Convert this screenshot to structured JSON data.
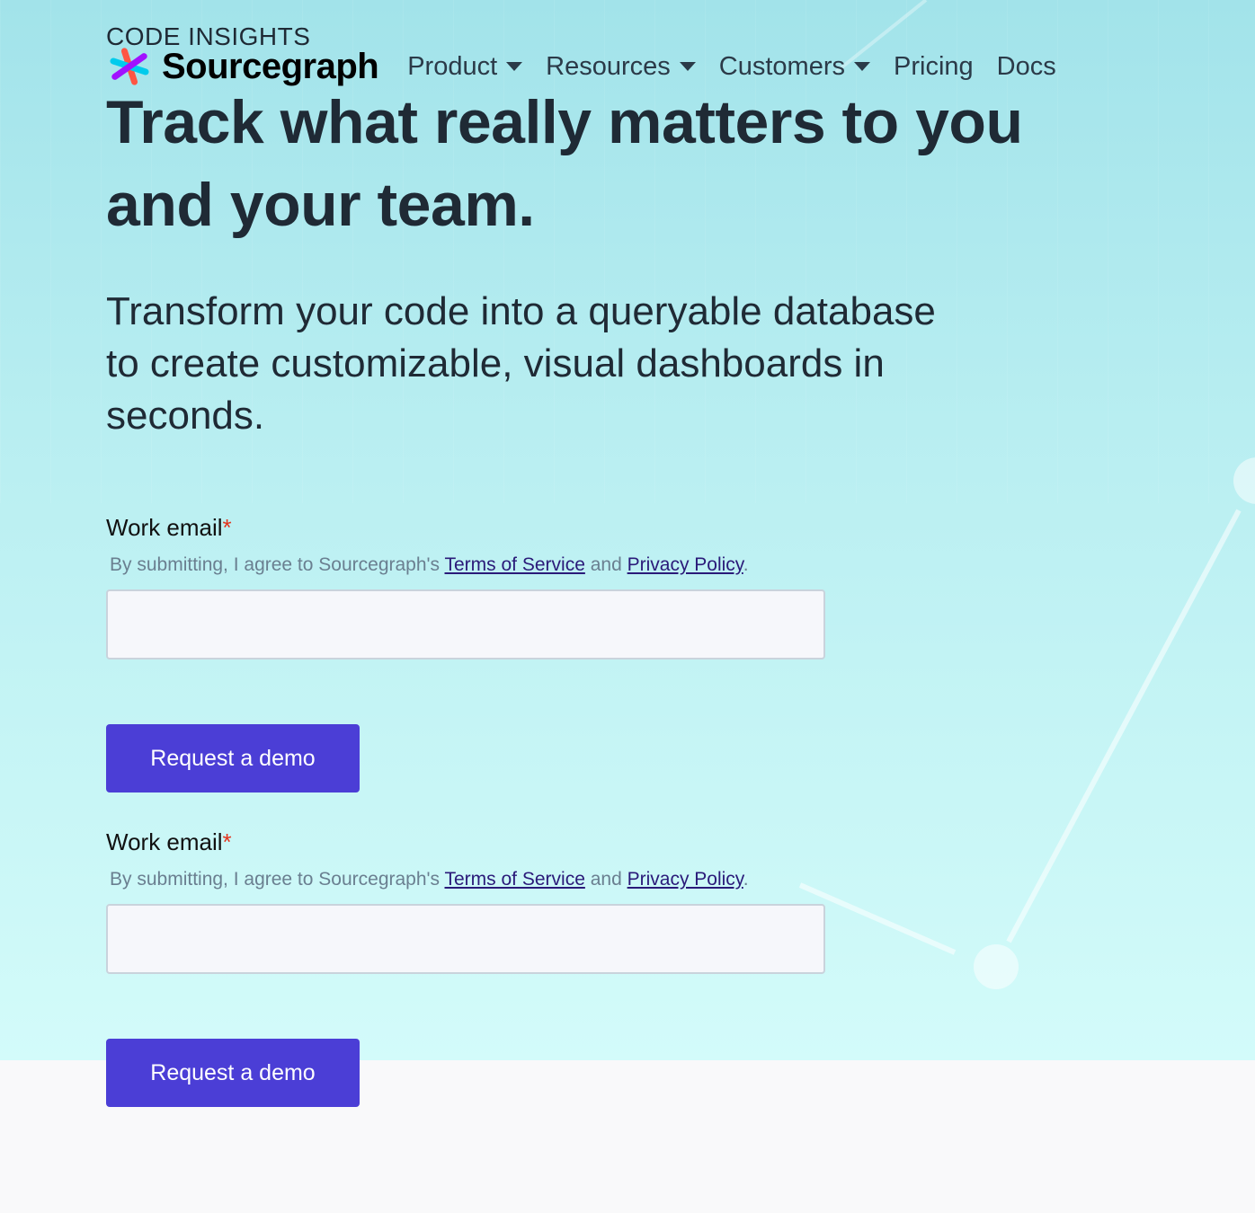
{
  "hero": {
    "eyebrow": "CODE INSIGHTS",
    "headline": "Track what really matters to you and your team.",
    "subhead": "Transform your code into a queryable database to create customizable, visual dashboards in seconds."
  },
  "nav": {
    "brand": "Sourcegraph",
    "items": [
      {
        "label": "Product",
        "dropdown": true
      },
      {
        "label": "Resources",
        "dropdown": true
      },
      {
        "label": "Customers",
        "dropdown": true
      },
      {
        "label": "Pricing",
        "dropdown": false
      },
      {
        "label": "Docs",
        "dropdown": false
      }
    ]
  },
  "forms": [
    {
      "label": "Work email",
      "required_mark": "*",
      "terms_prefix": "By submitting, I agree to Sourcegraph's ",
      "terms_link": "Terms of Service",
      "terms_mid": " and ",
      "privacy_link": "Privacy Policy",
      "terms_suffix": ".",
      "email_value": "",
      "button_label": "Request a demo"
    },
    {
      "label": "Work email",
      "required_mark": "*",
      "terms_prefix": "By submitting, I agree to Sourcegraph's ",
      "terms_link": "Terms of Service",
      "terms_mid": " and ",
      "privacy_link": "Privacy Policy",
      "terms_suffix": ".",
      "email_value": "",
      "button_label": "Request a demo"
    }
  ],
  "colors": {
    "brand_button": "#4b3ed6",
    "required": "#e3341d",
    "link": "#2a1a79",
    "hero_top": "#a2e3ea",
    "hero_bottom": "#d3fbfa"
  },
  "icons": {
    "logo": "sourcegraph-logo-icon",
    "dropdown": "caret-down-icon"
  }
}
